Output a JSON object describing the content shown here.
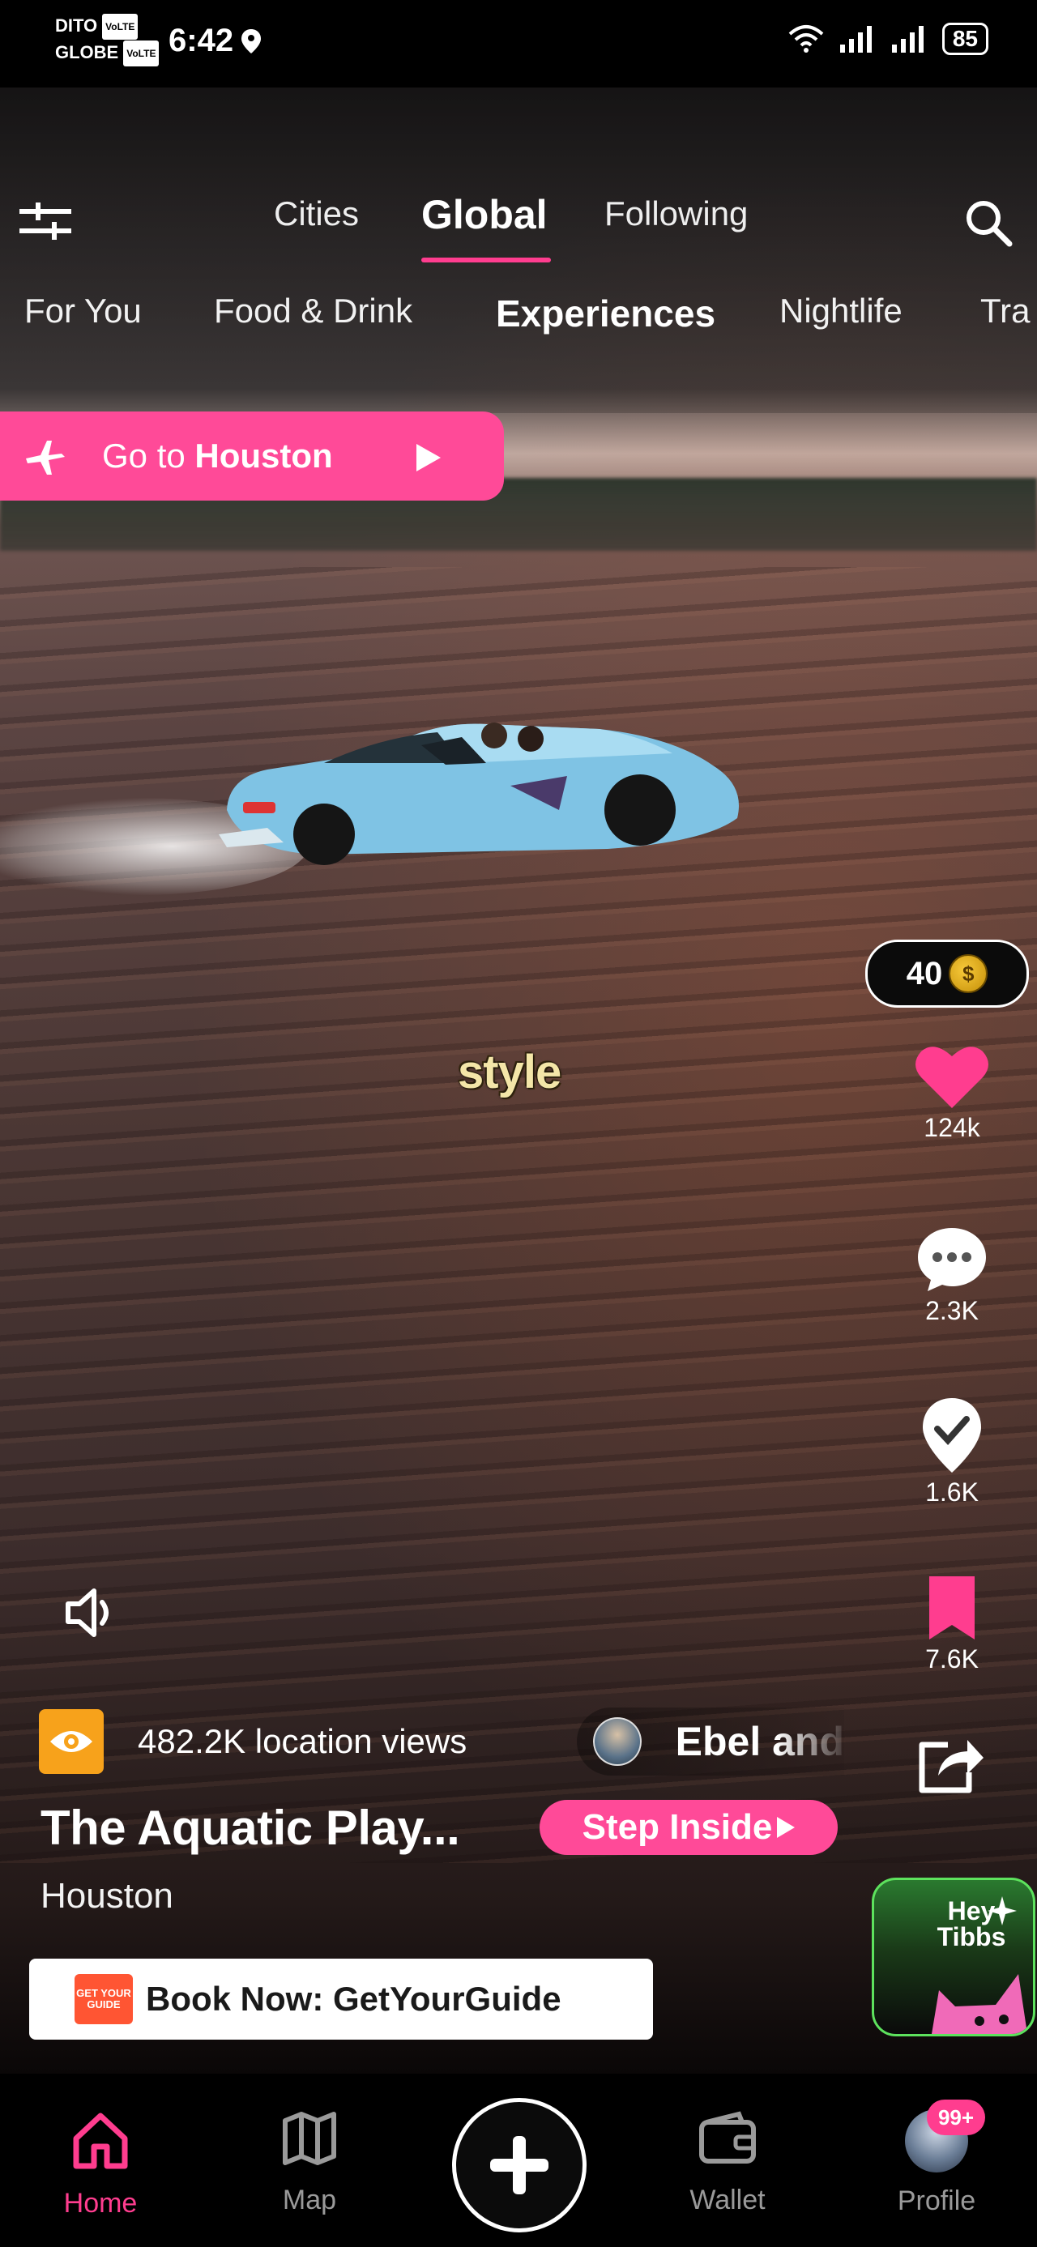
{
  "status_bar": {
    "carrier_1": "DITO",
    "carrier_2": "GLOBE",
    "carrier_tag": "VoLTE",
    "time": "6:42",
    "battery": "85"
  },
  "top_nav": {
    "tabs": [
      {
        "label": "Cities",
        "active": false
      },
      {
        "label": "Global",
        "active": true
      },
      {
        "label": "Following",
        "active": false
      }
    ],
    "categories": [
      {
        "label": "For You",
        "active": false
      },
      {
        "label": "Food & Drink",
        "active": false
      },
      {
        "label": "Experiences",
        "active": true
      },
      {
        "label": "Nightlife",
        "active": false
      },
      {
        "label": "Tra",
        "active": false
      }
    ]
  },
  "goto_banner": {
    "prefix": "Go to",
    "city": "Houston"
  },
  "video": {
    "caption": "style"
  },
  "right_rail": {
    "coins": "40",
    "likes": "124k",
    "comments": "2.3K",
    "checkins": "1.6K",
    "saves": "7.6K"
  },
  "info": {
    "views": "482.2K location views",
    "creator": "Ebel and",
    "title": "The Aquatic Play...",
    "step_inside": "Step Inside",
    "city": "Houston"
  },
  "book": {
    "logo_text": "GET YOUR GUIDE",
    "label": "Book Now: GetYourGuide"
  },
  "assistant": {
    "label": "Hey Tibbs"
  },
  "bottom_nav": {
    "items": [
      {
        "label": "Home",
        "active": true
      },
      {
        "label": "Map",
        "active": false
      },
      {
        "label": "Wallet",
        "active": false
      },
      {
        "label": "Profile",
        "active": false
      }
    ],
    "profile_badge": "99+"
  },
  "colors": {
    "accent": "#ff3d8f",
    "banner_pink": "#ff4a98",
    "views_badge": "#f7a21b",
    "tibbs_border": "#5de25d"
  }
}
